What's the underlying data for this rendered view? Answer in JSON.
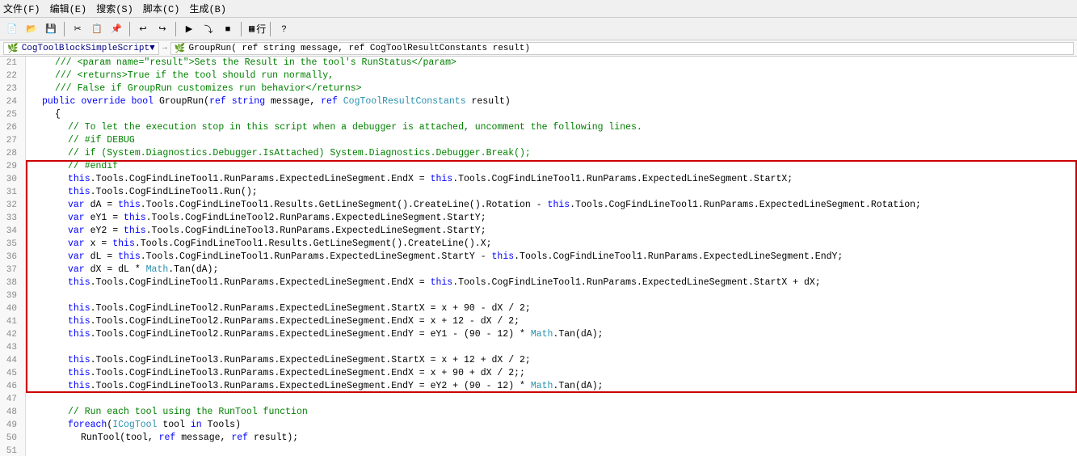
{
  "menu": {
    "items": [
      "文件(F)",
      "编辑(E)",
      "搜索(S)",
      "脚本(C)",
      "生成(B)"
    ]
  },
  "toolbar": {
    "run_label": "行",
    "question_icon": "?"
  },
  "nav": {
    "script_name": "CogToolBlockSimpleScript",
    "method_signature": "GroupRun( ref string message,  ref CogToolResultConstants result)"
  },
  "code": {
    "lines": [
      {
        "num": 21,
        "indent": 2,
        "content": "/// <param name=\"result\">Sets the Result in the tool's RunStatus</param>",
        "type": "comment"
      },
      {
        "num": 22,
        "indent": 2,
        "content": "/// <returns>True if the tool should run normally,",
        "type": "comment"
      },
      {
        "num": 23,
        "indent": 2,
        "content": "///           False if GroupRun customizes run behavior</returns>",
        "type": "comment"
      },
      {
        "num": 24,
        "indent": 1,
        "content": "public override bool GroupRun(ref string message, ref CogToolResultConstants result)",
        "type": "code"
      },
      {
        "num": 25,
        "indent": 2,
        "content": "{",
        "type": "code"
      },
      {
        "num": 26,
        "indent": 3,
        "content": "// To let the execution stop in this script when a debugger is attached, uncomment the following lines.",
        "type": "comment"
      },
      {
        "num": 27,
        "indent": 3,
        "content": "// #if DEBUG",
        "type": "comment"
      },
      {
        "num": 28,
        "indent": 3,
        "content": "// if (System.Diagnostics.Debugger.IsAttached) System.Diagnostics.Debugger.Break();",
        "type": "comment"
      },
      {
        "num": 29,
        "indent": 3,
        "content": "// #endif",
        "type": "comment",
        "selected_start": true
      },
      {
        "num": 30,
        "indent": 3,
        "content": "this.Tools.CogFindLineTool1.RunParams.ExpectedLineSegment.EndX = this.Tools.CogFindLineTool1.RunParams.ExpectedLineSegment.StartX;",
        "type": "code",
        "selected": true
      },
      {
        "num": 31,
        "indent": 3,
        "content": "this.Tools.CogFindLineTool1.Run();",
        "type": "code",
        "selected": true
      },
      {
        "num": 32,
        "indent": 3,
        "content": "var dA = this.Tools.CogFindLineTool1.Results.GetLineSegment().CreateLine().Rotation - this.Tools.CogFindLineTool1.RunParams.ExpectedLineSegment.Rotation;",
        "type": "code",
        "selected": true
      },
      {
        "num": 33,
        "indent": 3,
        "content": "var eY1 = this.Tools.CogFindLineTool2.RunParams.ExpectedLineSegment.StartY;",
        "type": "code",
        "selected": true
      },
      {
        "num": 34,
        "indent": 3,
        "content": "var eY2 = this.Tools.CogFindLineTool3.RunParams.ExpectedLineSegment.StartY;",
        "type": "code",
        "selected": true
      },
      {
        "num": 35,
        "indent": 3,
        "content": "var x = this.Tools.CogFindLineTool1.Results.GetLineSegment().CreateLine().X;",
        "type": "code",
        "selected": true
      },
      {
        "num": 36,
        "indent": 3,
        "content": "var dL = this.Tools.CogFindLineTool1.RunParams.ExpectedLineSegment.StartY - this.Tools.CogFindLineTool1.RunParams.ExpectedLineSegment.EndY;",
        "type": "code",
        "selected": true
      },
      {
        "num": 37,
        "indent": 3,
        "content": "var dX = dL * Math.Tan(dA);",
        "type": "code",
        "selected": true
      },
      {
        "num": 38,
        "indent": 3,
        "content": "this.Tools.CogFindLineTool1.RunParams.ExpectedLineSegment.EndX = this.Tools.CogFindLineTool1.RunParams.ExpectedLineSegment.StartX + dX;",
        "type": "code",
        "selected": true
      },
      {
        "num": 39,
        "indent": 0,
        "content": "",
        "type": "empty",
        "selected": true
      },
      {
        "num": 40,
        "indent": 3,
        "content": "this.Tools.CogFindLineTool2.RunParams.ExpectedLineSegment.StartX = x + 90 - dX / 2;",
        "type": "code",
        "selected": true
      },
      {
        "num": 41,
        "indent": 3,
        "content": "this.Tools.CogFindLineTool2.RunParams.ExpectedLineSegment.EndX = x + 12 - dX / 2;",
        "type": "code",
        "selected": true
      },
      {
        "num": 42,
        "indent": 3,
        "content": "this.Tools.CogFindLineTool2.RunParams.ExpectedLineSegment.EndY = eY1 - (90 - 12) * Math.Tan(dA);",
        "type": "code",
        "selected": true
      },
      {
        "num": 43,
        "indent": 0,
        "content": "",
        "type": "empty",
        "selected": true
      },
      {
        "num": 44,
        "indent": 3,
        "content": "this.Tools.CogFindLineTool3.RunParams.ExpectedLineSegment.StartX = x + 12 + dX / 2;",
        "type": "code",
        "selected": true
      },
      {
        "num": 45,
        "indent": 3,
        "content": "this.Tools.CogFindLineTool3.RunParams.ExpectedLineSegment.EndX = x + 90 + dX / 2;;",
        "type": "code",
        "selected": true
      },
      {
        "num": 46,
        "indent": 3,
        "content": "this.Tools.CogFindLineTool3.RunParams.ExpectedLineSegment.EndY = eY2 + (90 - 12) * Math.Tan(dA);",
        "type": "code",
        "selected": true,
        "selected_end": true
      },
      {
        "num": 47,
        "indent": 0,
        "content": "",
        "type": "empty"
      },
      {
        "num": 48,
        "indent": 3,
        "content": "// Run each tool using the RunTool function",
        "type": "comment"
      },
      {
        "num": 49,
        "indent": 3,
        "content": "foreach(ICogTool tool in Tools)",
        "type": "code"
      },
      {
        "num": 50,
        "indent": 4,
        "content": "RunTool(tool, ref message, ref result);",
        "type": "code"
      },
      {
        "num": 51,
        "indent": 0,
        "content": "",
        "type": "empty"
      }
    ]
  }
}
